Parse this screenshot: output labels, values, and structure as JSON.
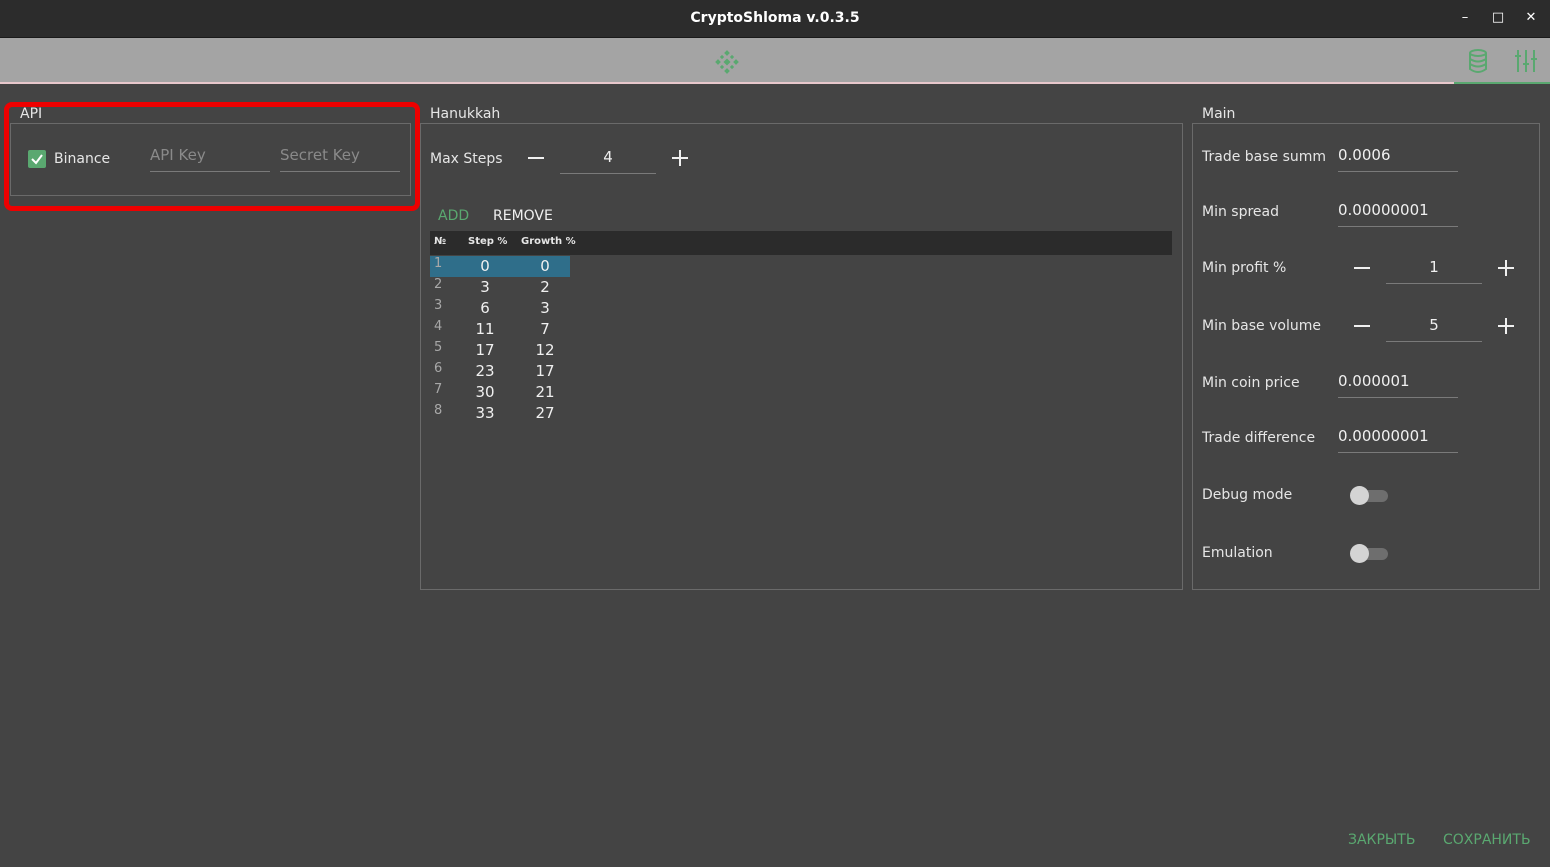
{
  "window": {
    "title": "CryptoShloma v.0.3.5",
    "minimize": "–",
    "maximize": "□",
    "close": "✕"
  },
  "toolbar": {
    "logo_icon": "binance-icon",
    "left_icon": "database-icon",
    "right_icon": "sliders-icon"
  },
  "api": {
    "group_title": "API",
    "exchange_label": "Binance",
    "exchange_checked": true,
    "api_key_placeholder": "API Key",
    "secret_key_placeholder": "Secret Key"
  },
  "hanukkah": {
    "group_title": "Hanukkah",
    "max_steps_label": "Max Steps",
    "max_steps_value": "4",
    "add_label": "ADD",
    "remove_label": "REMOVE",
    "columns": [
      "№",
      "Step %",
      "Growth %"
    ],
    "rows": [
      {
        "n": "1",
        "step": "0",
        "growth": "0"
      },
      {
        "n": "2",
        "step": "3",
        "growth": "2"
      },
      {
        "n": "3",
        "step": "6",
        "growth": "3"
      },
      {
        "n": "4",
        "step": "11",
        "growth": "7"
      },
      {
        "n": "5",
        "step": "17",
        "growth": "12"
      },
      {
        "n": "6",
        "step": "23",
        "growth": "17"
      },
      {
        "n": "7",
        "step": "30",
        "growth": "21"
      },
      {
        "n": "8",
        "step": "33",
        "growth": "27"
      }
    ]
  },
  "main": {
    "group_title": "Main",
    "trade_base_summ_label": "Trade base summ",
    "trade_base_summ_value": "0.0006",
    "min_spread_label": "Min spread",
    "min_spread_value": "0.00000001",
    "min_profit_label": "Min profit %",
    "min_profit_value": "1",
    "min_base_volume_label": "Min base volume",
    "min_base_volume_value": "5",
    "min_coin_price_label": "Min coin price",
    "min_coin_price_value": "0.000001",
    "trade_difference_label": "Trade difference",
    "trade_difference_value": "0.00000001",
    "debug_mode_label": "Debug mode",
    "debug_mode_on": false,
    "emulation_label": "Emulation",
    "emulation_on": false
  },
  "footer": {
    "close_label": "ЗАКРЫТЬ",
    "save_label": "СОХРАНИТЬ"
  },
  "colors": {
    "accent": "#5aa870",
    "background": "#444444",
    "highlight": "#ee0000",
    "selected_row": "#2f6e8a"
  }
}
